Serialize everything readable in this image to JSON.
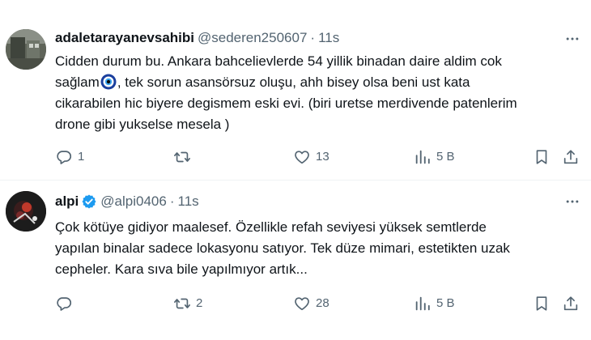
{
  "tweets": [
    {
      "author_name": "adaletarayanevsahibi",
      "handle": "@sederen250607",
      "separator": "·",
      "time": "11s",
      "verified": false,
      "lines": [
        "Cidden durum bu. Ankara bahcelievlerde 54 yillik binadan daire aldim cok",
        "sağlam",
        ", tek sorun asansörsuz oluşu,  ahh bisey olsa beni ust kata",
        "cikarabilen hic biyere degismem eski evi. (biri uretse merdivende patenlerim",
        "drone gibi yukselse mesela )"
      ],
      "actions": {
        "replies": "1",
        "reposts": "",
        "likes": "13",
        "views": "5 B"
      }
    },
    {
      "author_name": "alpi",
      "handle": "@alpi0406",
      "separator": "·",
      "time": "11s",
      "verified": true,
      "lines": [
        "Çok kötüye gidiyor maalesef. Özellikle refah seviyesi yüksek semtlerde",
        "yapılan binalar sadece lokasyonu satıyor. Tek düze mimari, estetikten uzak",
        "cepheler. Kara sıva bile yapılmıyor artık..."
      ],
      "actions": {
        "replies": "",
        "reposts": "2",
        "likes": "28",
        "views": "5 B"
      }
    }
  ],
  "icons": {
    "more": "more-horizontal-icon",
    "reply": "reply-bubble-icon",
    "repost": "repost-arrows-icon",
    "like": "heart-icon",
    "views": "views-bar-chart-icon",
    "bookmark": "bookmark-icon",
    "share": "share-upload-icon",
    "verified": "verified-badge-icon",
    "emoji": "nazar-boncugu-emoji-icon"
  },
  "colors": {
    "text_primary": "#0f1419",
    "text_secondary": "#536471",
    "verified_blue": "#1d9bf0",
    "divider": "#eff3f4"
  }
}
